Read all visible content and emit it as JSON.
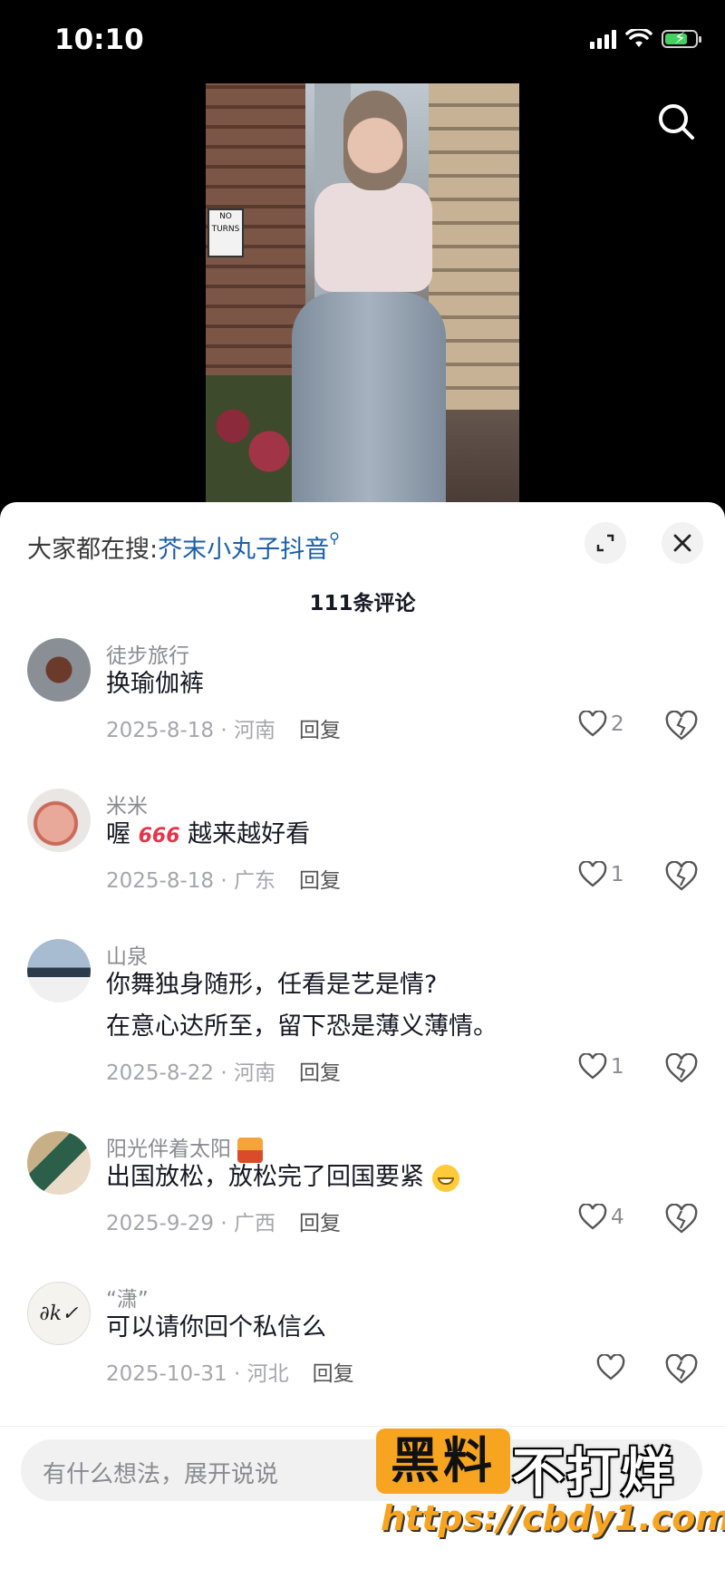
{
  "status": {
    "time": "10:10"
  },
  "sheet": {
    "hot_search_prefix": "大家都在搜:",
    "hot_search_keyword": "芥末小丸子抖音",
    "comment_count": "111条评论",
    "input_placeholder": "有什么想法，展开说说"
  },
  "comments": [
    {
      "user": "徒步旅行",
      "text": "换瑜伽裤",
      "date": "2025-8-18 · 河南",
      "reply": "回复",
      "likes": "2"
    },
    {
      "user": "米米",
      "text_before": "喔",
      "emoji": "666",
      "text_after": "越来越好看",
      "date": "2025-8-18 · 广东",
      "reply": "回复",
      "likes": "1"
    },
    {
      "user": "山泉",
      "text_line1": "你舞独身随形，任看是艺是情?",
      "text_line2": "在意心达所至，留下恐是薄义薄情。",
      "date": "2025-8-22 · 河南",
      "reply": "回复",
      "likes": "1"
    },
    {
      "user": "阳光伴着太阳",
      "text": "出国放松，放松完了回国要紧",
      "date": "2025-9-29 · 广西",
      "reply": "回复",
      "likes": "4"
    },
    {
      "user": "“潇”",
      "text": "可以请你回个私信么",
      "date": "2025-10-31 · 河北",
      "reply": "回复",
      "likes": ""
    }
  ],
  "video": {
    "sign_text": "NO TURNS"
  },
  "watermark": {
    "brand": "黑料",
    "slogan": "不打烊",
    "url": "https://cbdy1.com"
  },
  "colors": {
    "keyword": "#1b5fa8",
    "watermark_orange": "#f7a521",
    "battery": "#44d162"
  },
  "icons": [
    "search-icon",
    "expand-icon",
    "close-icon",
    "heart-icon",
    "dislike-heart-icon",
    "wifi-icon",
    "signal-icon",
    "battery-icon"
  ]
}
